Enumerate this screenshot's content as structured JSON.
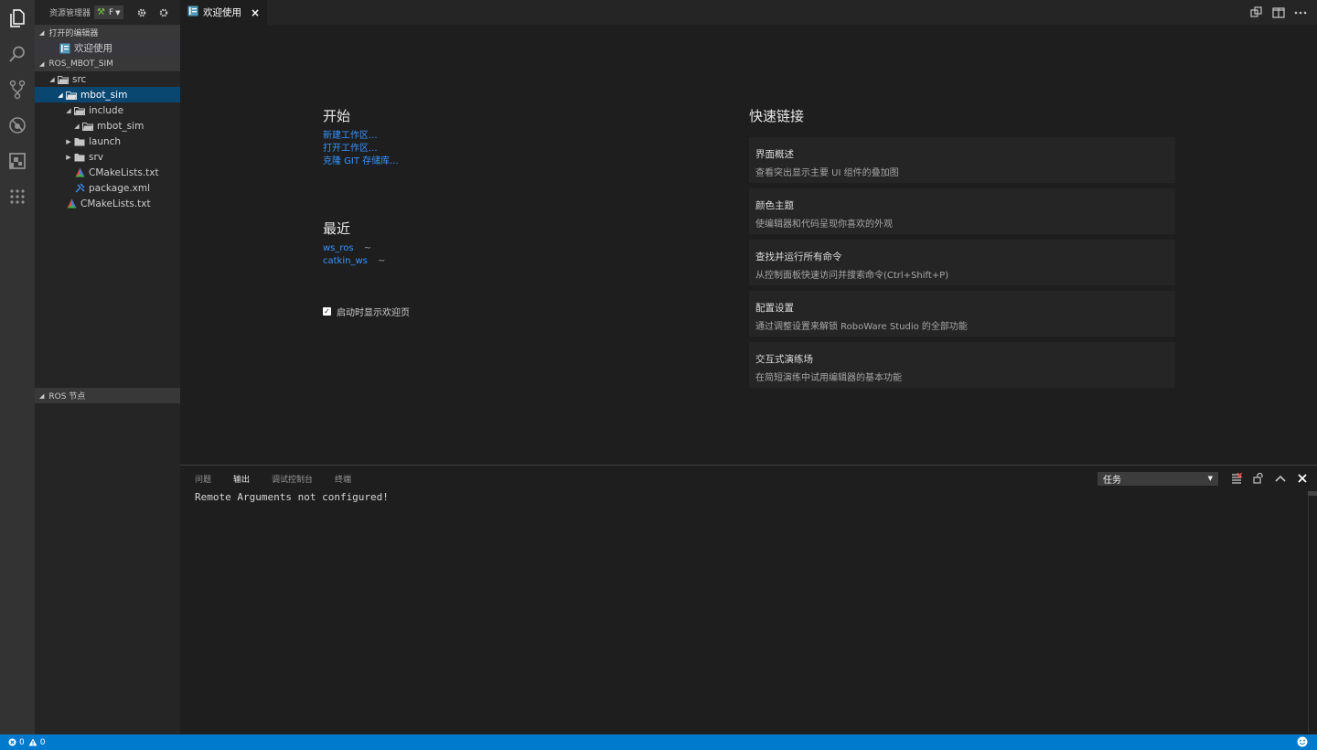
{
  "colors": {
    "accent": "#007acc",
    "link": "#3794ff",
    "selection": "#094771",
    "activity_bar": "#333333",
    "sidebar": "#252526",
    "editor": "#1e1e1e"
  },
  "activity_bar": {
    "icons": [
      "files-icon",
      "search-icon",
      "source-control-icon",
      "debug-icon",
      "extensions-icon",
      "ros-icon"
    ]
  },
  "sidebar": {
    "title": "资源管理器",
    "ros_selector_label": "F",
    "open_editors": {
      "title": "打开的编辑器",
      "items": [
        {
          "label": "欢迎使用"
        }
      ]
    },
    "workspace": {
      "title": "ROS_MBOT_SIM",
      "tree": [
        {
          "label": "src"
        },
        {
          "label": "mbot_sim"
        },
        {
          "label": "include"
        },
        {
          "label": "mbot_sim"
        },
        {
          "label": "launch"
        },
        {
          "label": "srv"
        },
        {
          "label": "CMakeLists.txt"
        },
        {
          "label": "package.xml"
        },
        {
          "label": "CMakeLists.txt"
        }
      ]
    },
    "ros_nodes": {
      "title": "ROS 节点"
    }
  },
  "editor": {
    "tab": {
      "label": "欢迎使用",
      "close": "×"
    },
    "welcome": {
      "start": {
        "heading": "开始",
        "links": [
          "新建工作区...",
          "打开工作区...",
          "克隆 GIT 存储库..."
        ]
      },
      "recent": {
        "heading": "最近",
        "items": [
          {
            "name": "ws_ros",
            "path": "~"
          },
          {
            "name": "catkin_ws",
            "path": "~"
          }
        ]
      },
      "show_on_startup": {
        "label": "启动时显示欢迎页",
        "checked": true
      },
      "quick_links": {
        "heading": "快速链接",
        "cards": [
          {
            "title": "界面概述",
            "desc": "查看突出显示主要 UI 组件的叠加图"
          },
          {
            "title": "颜色主题",
            "desc": "使编辑器和代码呈现你喜欢的外观"
          },
          {
            "title": "查找并运行所有命令",
            "desc": "从控制面板快速访问并搜索命令(Ctrl+Shift+P)"
          },
          {
            "title": "配置设置",
            "desc": "通过调整设置来解锁 RoboWare Studio 的全部功能"
          },
          {
            "title": "交互式演练场",
            "desc": "在简短演练中试用编辑器的基本功能"
          }
        ]
      }
    }
  },
  "panel": {
    "tabs": [
      "问题",
      "输出",
      "调试控制台",
      "终端"
    ],
    "active_tab": "输出",
    "channel_select": "任务",
    "output_text": "Remote Arguments not configured!"
  },
  "statusbar": {
    "errors": "0",
    "warnings": "0"
  }
}
